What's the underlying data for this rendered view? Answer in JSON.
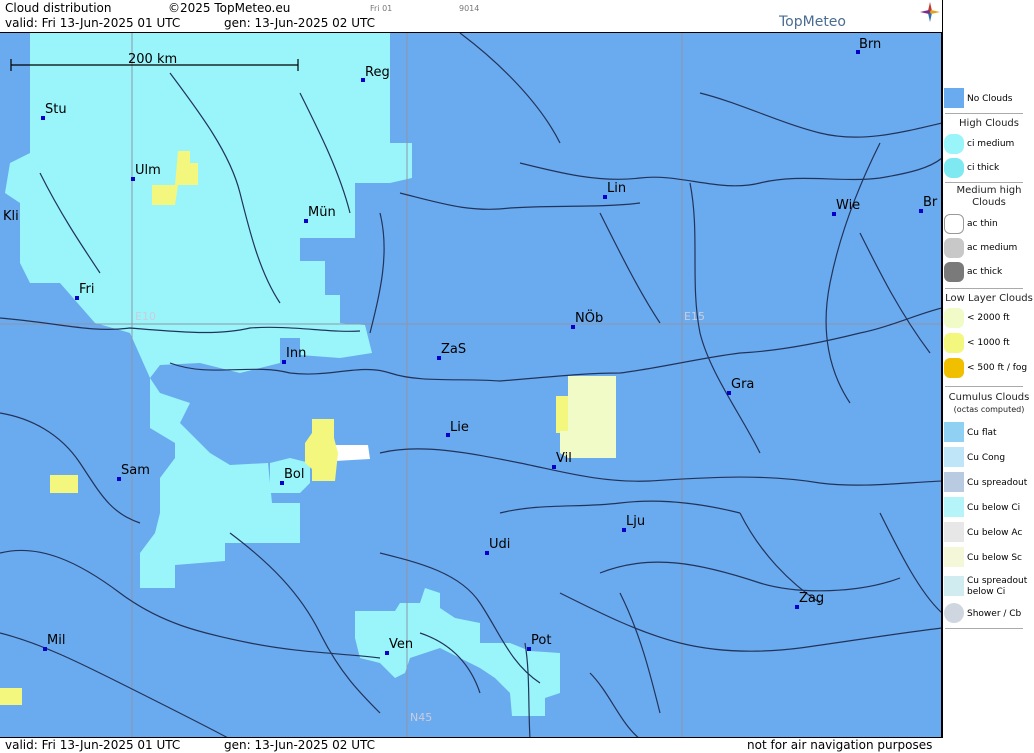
{
  "header": {
    "title": "Cloud distribution",
    "copyright": "©2025 TopMeteo.eu",
    "day_small": "Fri 01",
    "code_small": "9014",
    "valid": "valid:  Fri  13-Jun-2025  01 UTC",
    "gen": "gen: 13-Jun-2025 02 UTC",
    "logo": "TopMeteo"
  },
  "footer": {
    "valid": "valid:  Fri  13-Jun-2025  01 UTC",
    "gen": "gen: 13-Jun-2025 02 UTC",
    "disclaimer": "not for air navigation purposes"
  },
  "map": {
    "scale_label": "200 km",
    "grid_labels": {
      "e10": "E10",
      "e15": "E15",
      "n45": "N45"
    },
    "cities": [
      {
        "name": "Brn"
      },
      {
        "name": "Reg"
      },
      {
        "name": "Stu"
      },
      {
        "name": "Ulm"
      },
      {
        "name": "Lin"
      },
      {
        "name": "Kli"
      },
      {
        "name": "Mün"
      },
      {
        "name": "Wie"
      },
      {
        "name": "Br"
      },
      {
        "name": "Fri"
      },
      {
        "name": "NÖb"
      },
      {
        "name": "Inn"
      },
      {
        "name": "ZaS"
      },
      {
        "name": "Gra"
      },
      {
        "name": "Lie"
      },
      {
        "name": "Vil"
      },
      {
        "name": "Sam"
      },
      {
        "name": "Bol"
      },
      {
        "name": "Lju"
      },
      {
        "name": "Udi"
      },
      {
        "name": "Zag"
      },
      {
        "name": "Mil"
      },
      {
        "name": "Pot"
      },
      {
        "name": "Ven"
      }
    ],
    "colors": {
      "no_clouds": "#6aaaee",
      "ci_medium": "#99f5fa",
      "low_2000": "#f1fbc8",
      "low_1000": "#f3f77d",
      "lines": "#22335a"
    }
  },
  "legend": {
    "items": [
      {
        "label": "No Clouds",
        "color": "#6aaaee"
      },
      {
        "label": "High Clouds",
        "type": "header"
      },
      {
        "label": "ci medium",
        "color": "#99f5fa"
      },
      {
        "label": "ci thick",
        "color": "#7fe9f1"
      },
      {
        "label": "Medium high Clouds",
        "type": "header"
      },
      {
        "label": "ac thin",
        "color": "#ffffff"
      },
      {
        "label": "ac medium",
        "color": "#c8c8c8"
      },
      {
        "label": "ac thick",
        "color": "#7a7a7a"
      },
      {
        "label": "Low Layer Clouds",
        "type": "header"
      },
      {
        "label": "< 2000 ft",
        "color": "#f1fbc8"
      },
      {
        "label": "< 1000 ft",
        "color": "#f3f77d"
      },
      {
        "label": "< 500 ft / fog",
        "color": "#f0c000"
      },
      {
        "label": "Cumulus Clouds",
        "type": "header"
      },
      {
        "label": "(octas computed)",
        "type": "sub"
      },
      {
        "label": "Cu flat",
        "color": "#8fd0f3"
      },
      {
        "label": "Cu Cong",
        "color": "#bfe6f8"
      },
      {
        "label": "Cu spreadout",
        "color": "#b9cbe0"
      },
      {
        "label": "Cu below Ci",
        "color": "#b5f5fa"
      },
      {
        "label": "Cu below Ac",
        "color": "#e7e7e7"
      },
      {
        "label": "Cu below Sc",
        "color": "#f4f8d8"
      },
      {
        "label": "Cu spreadout below Ci",
        "color": "#d0ecf0"
      },
      {
        "label": "Shower / Cb",
        "color": "#cfd6df"
      }
    ]
  }
}
